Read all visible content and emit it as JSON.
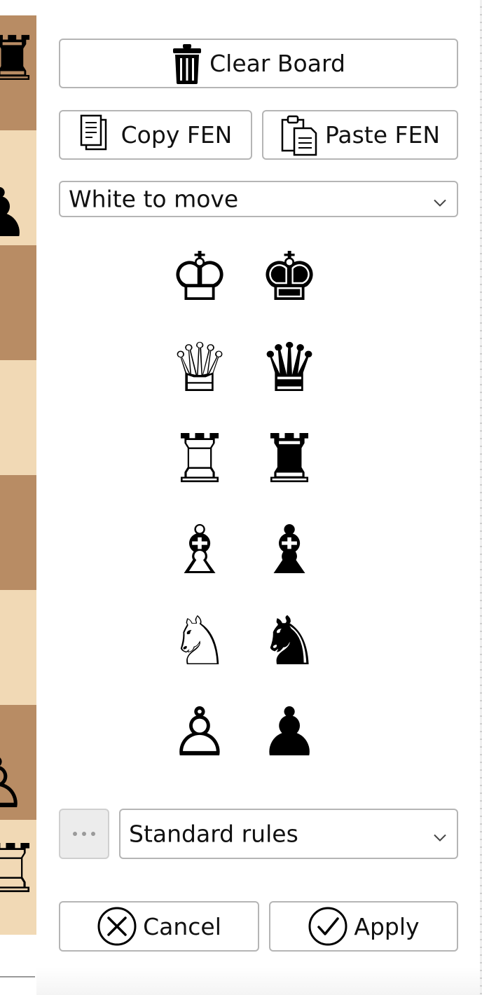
{
  "toolbar": {
    "clear_board_label": "Clear Board",
    "copy_fen_label": "Copy FEN",
    "paste_fen_label": "Paste FEN"
  },
  "side_to_move": {
    "selected": "White to move"
  },
  "palette": {
    "rows": [
      {
        "white": "♔",
        "black": "♚"
      },
      {
        "white": "♕",
        "black": "♛"
      },
      {
        "white": "♖",
        "black": "♜"
      },
      {
        "white": "♗",
        "black": "♝"
      },
      {
        "white": "♘",
        "black": "♞"
      },
      {
        "white": "♙",
        "black": "♟"
      }
    ]
  },
  "board_strip": {
    "colors": {
      "dark": "#b88c64",
      "light": "#f1d9b5"
    },
    "squares": [
      "dark",
      "light",
      "dark",
      "light",
      "dark",
      "light",
      "dark",
      "light"
    ]
  },
  "rules": {
    "selected": "Standard rules"
  },
  "footer": {
    "cancel_label": "Cancel",
    "apply_label": "Apply"
  },
  "icons": {
    "clear": "trash-icon",
    "copy": "copy-document-icon",
    "paste": "clipboard-paste-icon",
    "cancel": "x-circle-icon",
    "apply": "check-circle-icon",
    "chevron": "chevron-down-icon",
    "more": "ellipsis-icon"
  }
}
